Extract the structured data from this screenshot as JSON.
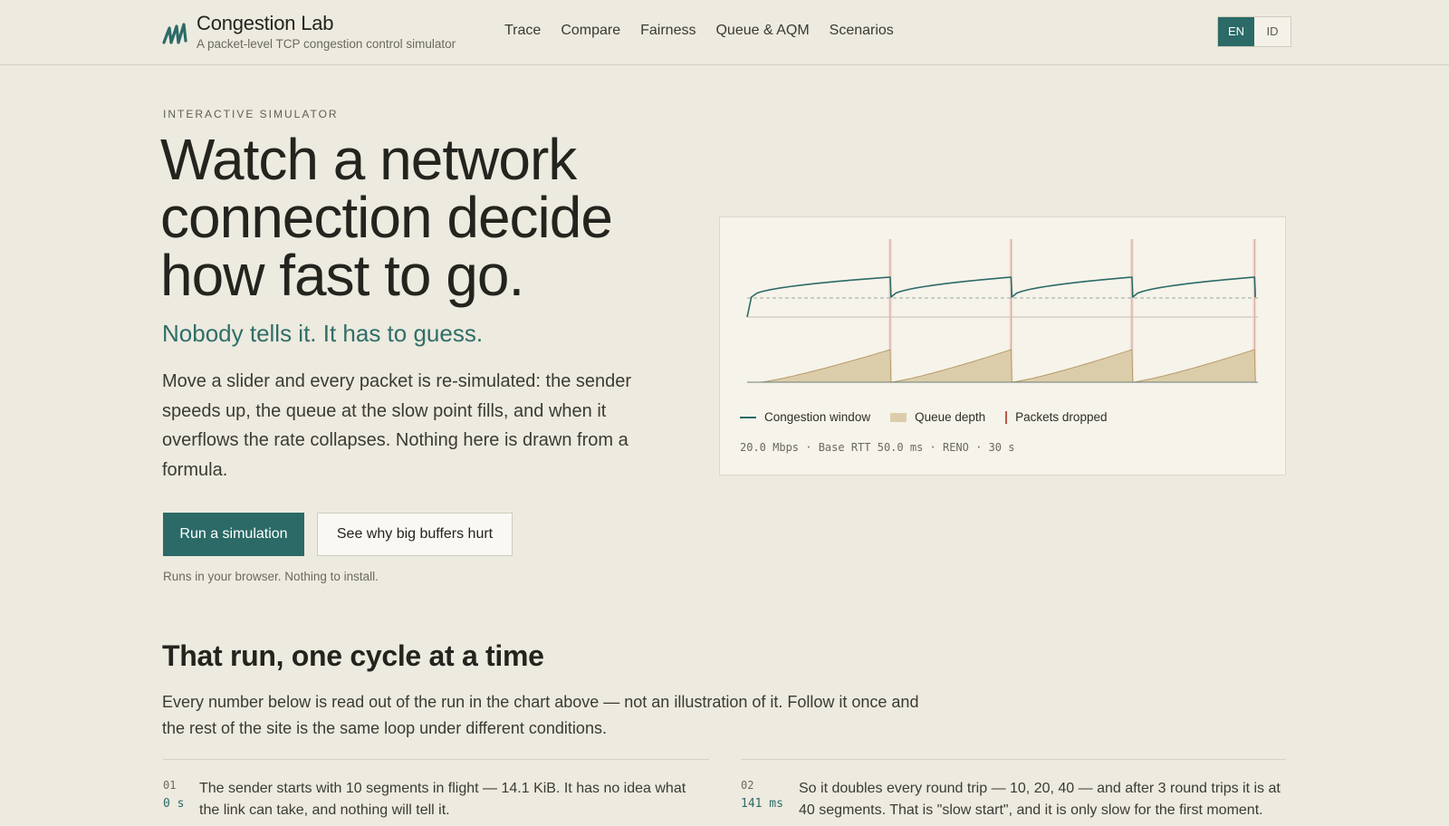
{
  "header": {
    "brand_name": "Congestion Lab",
    "brand_tagline": "A packet-level TCP congestion control simulator",
    "nav": [
      "Trace",
      "Compare",
      "Fairness",
      "Queue & AQM",
      "Scenarios"
    ],
    "lang": {
      "en": "EN",
      "id": "ID",
      "active": "EN"
    }
  },
  "hero": {
    "eyebrow": "INTERACTIVE SIMULATOR",
    "headline_line1": "Watch a network",
    "headline_line2": "connection decide",
    "headline_line3": "how fast to go.",
    "subhead": "Nobody tells it. It has to guess.",
    "lede": "Move a slider and every packet is re-simulated: the sender speeds up, the queue at the slow point fills, and when it overflows the rate collapses. Nothing here is drawn from a formula.",
    "primary_cta": "Run a simulation",
    "secondary_cta": "See why big buffers hurt",
    "note": "Runs in your browser. Nothing to install."
  },
  "chart": {
    "legend": {
      "cwnd": "Congestion window",
      "queue": "Queue depth",
      "drops": "Packets dropped"
    },
    "meta": "20.0 Mbps · Base RTT 50.0 ms · RENO · 30 s"
  },
  "chart_data": {
    "type": "line",
    "title": "",
    "xlabel": "",
    "ylabel": "",
    "duration_s": 30,
    "cycle_count": 4,
    "drop_times_s": [
      8.4,
      15.5,
      22.6,
      29.8
    ],
    "series": [
      {
        "name": "Congestion window",
        "kind": "line",
        "color": "#2b6a67",
        "shape": "sawtooth",
        "relative_peak": 1.0,
        "relative_trough": 0.5
      },
      {
        "name": "Queue depth",
        "kind": "area",
        "color": "#dccdaa",
        "shape": "ramp-to-full then empty",
        "relative_peak": 1.0,
        "relative_trough": 0.0
      },
      {
        "name": "Packets dropped",
        "kind": "marker",
        "color": "#b8574a"
      }
    ],
    "grid": false,
    "legend_position": "bottom-left"
  },
  "section": {
    "title": "That run, one cycle at a time",
    "lede": "Every number below is read out of the run in the chart above — not an illustration of it. Follow it once and the rest of the site is the same loop under different conditions.",
    "steps": [
      {
        "num": "01",
        "time": "0 s",
        "text": "The sender starts with 10 segments in flight — 14.1 KiB. It has no idea what the link can take, and nothing will tell it."
      },
      {
        "num": "02",
        "time": "141 ms",
        "text": "So it doubles every round trip — 10, 20, 40 — and after 3 round trips it is at 40 segments. That is \"slow start\", and it is only slow for the first moment."
      }
    ]
  },
  "colors": {
    "accent": "#2b6a67",
    "background": "#edeadf",
    "card": "#f6f3ea",
    "queue_fill": "#dccdaa",
    "drop": "#b8574a"
  }
}
